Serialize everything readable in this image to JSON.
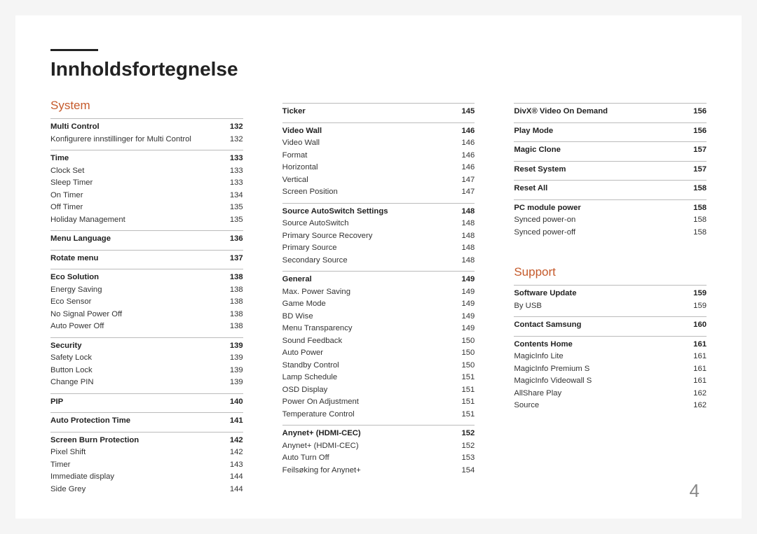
{
  "page_number": "4",
  "title": "Innholdsfortegnelse",
  "columns": [
    {
      "groups": [
        {
          "chapter": "System"
        },
        {
          "head": [
            "Multi Control",
            "132"
          ],
          "items": [
            [
              "Konfigurere innstillinger for Multi Control",
              "132"
            ]
          ]
        },
        {
          "head": [
            "Time",
            "133"
          ],
          "items": [
            [
              "Clock Set",
              "133"
            ],
            [
              "Sleep Timer",
              "133"
            ],
            [
              "On Timer",
              "134"
            ],
            [
              "Off Timer",
              "135"
            ],
            [
              "Holiday Management",
              "135"
            ]
          ]
        },
        {
          "head": [
            "Menu Language",
            "136"
          ]
        },
        {
          "head": [
            "Rotate menu",
            "137"
          ]
        },
        {
          "head": [
            "Eco Solution",
            "138"
          ],
          "items": [
            [
              "Energy Saving",
              "138"
            ],
            [
              "Eco Sensor",
              "138"
            ],
            [
              "No Signal Power Off",
              "138"
            ],
            [
              "Auto Power Off",
              "138"
            ]
          ]
        },
        {
          "head": [
            "Security",
            "139"
          ],
          "items": [
            [
              "Safety Lock",
              "139"
            ],
            [
              "Button Lock",
              "139"
            ],
            [
              "Change PIN",
              "139"
            ]
          ]
        },
        {
          "head": [
            "PIP",
            "140"
          ]
        },
        {
          "head": [
            "Auto Protection Time",
            "141"
          ]
        },
        {
          "head": [
            "Screen Burn Protection",
            "142"
          ],
          "items": [
            [
              "Pixel Shift",
              "142"
            ],
            [
              "Timer",
              "143"
            ],
            [
              "Immediate display",
              "144"
            ],
            [
              "Side Grey",
              "144"
            ]
          ]
        }
      ]
    },
    {
      "groups": [
        {
          "head": [
            "Ticker",
            "145"
          ]
        },
        {
          "head": [
            "Video Wall",
            "146"
          ],
          "items": [
            [
              "Video Wall",
              "146"
            ],
            [
              "Format",
              "146"
            ],
            [
              "Horizontal",
              "146"
            ],
            [
              "Vertical",
              "147"
            ],
            [
              "Screen Position",
              "147"
            ]
          ]
        },
        {
          "head": [
            "Source AutoSwitch Settings",
            "148"
          ],
          "items": [
            [
              "Source AutoSwitch",
              "148"
            ],
            [
              "Primary Source Recovery",
              "148"
            ],
            [
              "Primary Source",
              "148"
            ],
            [
              "Secondary Source",
              "148"
            ]
          ]
        },
        {
          "head": [
            "General",
            "149"
          ],
          "items": [
            [
              "Max. Power Saving",
              "149"
            ],
            [
              "Game Mode",
              "149"
            ],
            [
              "BD Wise",
              "149"
            ],
            [
              "Menu Transparency",
              "149"
            ],
            [
              "Sound Feedback",
              "150"
            ],
            [
              "Auto Power",
              "150"
            ],
            [
              "Standby Control",
              "150"
            ],
            [
              "Lamp Schedule",
              "151"
            ],
            [
              "OSD Display",
              "151"
            ],
            [
              "Power On Adjustment",
              "151"
            ],
            [
              "Temperature Control",
              "151"
            ]
          ]
        },
        {
          "head": [
            "Anynet+ (HDMI-CEC)",
            "152"
          ],
          "items": [
            [
              "Anynet+ (HDMI-CEC)",
              "152"
            ],
            [
              "Auto Turn Off",
              "153"
            ],
            [
              "Feilsøking for Anynet+",
              "154"
            ]
          ]
        }
      ]
    },
    {
      "groups": [
        {
          "head": [
            "DivX® Video On Demand",
            "156"
          ]
        },
        {
          "head": [
            "Play Mode",
            "156"
          ]
        },
        {
          "head": [
            "Magic Clone",
            "157"
          ]
        },
        {
          "head": [
            "Reset System",
            "157"
          ]
        },
        {
          "head": [
            "Reset All",
            "158"
          ]
        },
        {
          "head": [
            "PC module power",
            "158"
          ],
          "items": [
            [
              "Synced power-on",
              "158"
            ],
            [
              "Synced power-off",
              "158"
            ]
          ]
        },
        {
          "spacer": true
        },
        {
          "chapter": "Support"
        },
        {
          "head": [
            "Software Update",
            "159"
          ],
          "items": [
            [
              "By USB",
              "159"
            ]
          ]
        },
        {
          "head": [
            "Contact Samsung",
            "160"
          ]
        },
        {
          "head": [
            "Contents Home",
            "161"
          ],
          "items": [
            [
              "MagicInfo Lite",
              "161"
            ],
            [
              "MagicInfo Premium S",
              "161"
            ],
            [
              "MagicInfo Videowall S",
              "161"
            ],
            [
              "AllShare Play",
              "162"
            ],
            [
              "Source",
              "162"
            ]
          ]
        }
      ]
    }
  ]
}
